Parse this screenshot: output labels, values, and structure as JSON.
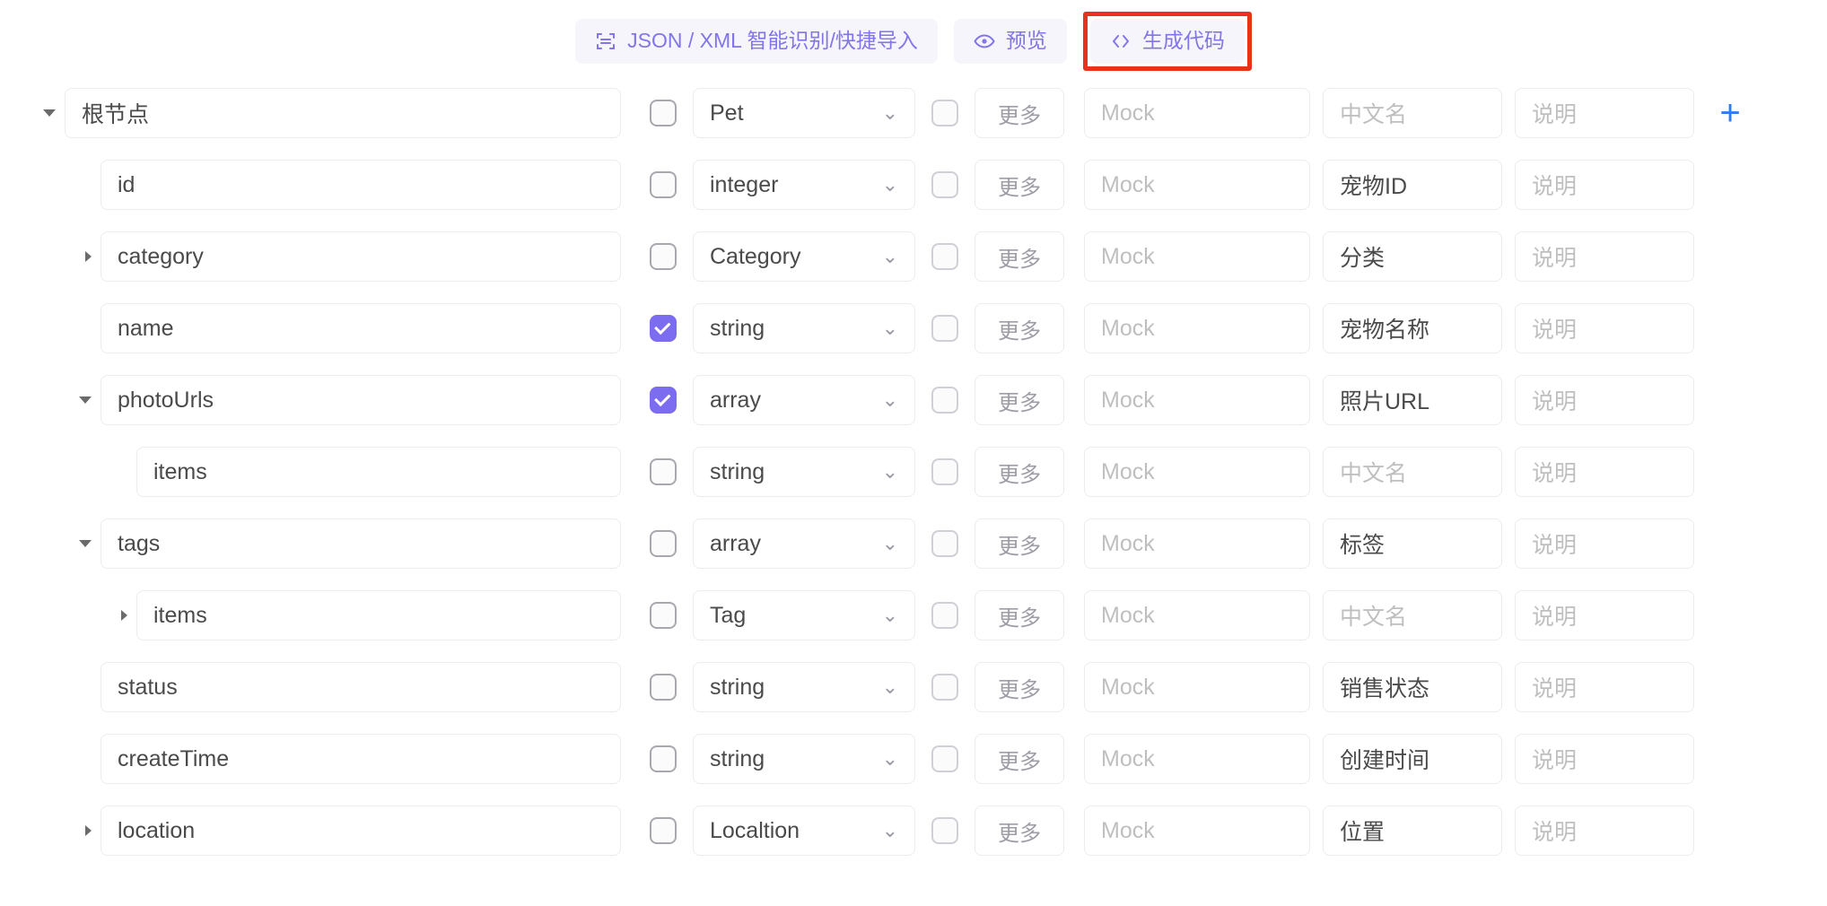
{
  "toolbar": {
    "import_label": "JSON / XML 智能识别/快捷导入",
    "import_icon": "scan-icon",
    "preview_label": "预览",
    "preview_icon": "eye-icon",
    "generate_label": "生成代码",
    "generate_icon": "code-icon",
    "accent_color": "#8275e8",
    "highlight_color": "#e8321c"
  },
  "columns": {
    "more_label": "更多",
    "mock_placeholder": "Mock",
    "cn_placeholder": "中文名",
    "desc_placeholder": "说明",
    "add_label": "+"
  },
  "rows": [
    {
      "name": "根节点",
      "indent": 0,
      "caret": "open",
      "required": false,
      "type": "Pet",
      "more": "更多",
      "mock": "",
      "cn": "",
      "desc": "",
      "show_add": true
    },
    {
      "name": "id",
      "indent": 1,
      "caret": "none",
      "required": false,
      "type": "integer",
      "more": "更多",
      "mock": "",
      "cn": "宠物ID",
      "desc": "",
      "show_add": false
    },
    {
      "name": "category",
      "indent": 1,
      "caret": "closed",
      "required": false,
      "type": "Category",
      "more": "更多",
      "mock": "",
      "cn": "分类",
      "desc": "",
      "show_add": false
    },
    {
      "name": "name",
      "indent": 1,
      "caret": "none",
      "required": true,
      "type": "string",
      "more": "更多",
      "mock": "",
      "cn": "宠物名称",
      "desc": "",
      "show_add": false
    },
    {
      "name": "photoUrls",
      "indent": 1,
      "caret": "open",
      "required": true,
      "type": "array",
      "more": "更多",
      "mock": "",
      "cn": "照片URL",
      "desc": "",
      "show_add": false
    },
    {
      "name": "items",
      "indent": 2,
      "caret": "none",
      "required": false,
      "type": "string",
      "more": "更多",
      "mock": "",
      "cn": "",
      "desc": "",
      "show_add": false
    },
    {
      "name": "tags",
      "indent": 1,
      "caret": "open",
      "required": false,
      "type": "array",
      "more": "更多",
      "mock": "",
      "cn": "标签",
      "desc": "",
      "show_add": false
    },
    {
      "name": "items",
      "indent": 2,
      "caret": "closed",
      "required": false,
      "type": "Tag",
      "more": "更多",
      "mock": "",
      "cn": "",
      "desc": "",
      "show_add": false
    },
    {
      "name": "status",
      "indent": 1,
      "caret": "none",
      "required": false,
      "type": "string",
      "more": "更多",
      "mock": "",
      "cn": "销售状态",
      "desc": "",
      "show_add": false
    },
    {
      "name": "createTime",
      "indent": 1,
      "caret": "none",
      "required": false,
      "type": "string",
      "more": "更多",
      "mock": "",
      "cn": "创建时间",
      "desc": "",
      "show_add": false
    },
    {
      "name": "location",
      "indent": 1,
      "caret": "closed",
      "required": false,
      "type": "Localtion",
      "more": "更多",
      "mock": "",
      "cn": "位置",
      "desc": "",
      "show_add": false
    }
  ]
}
